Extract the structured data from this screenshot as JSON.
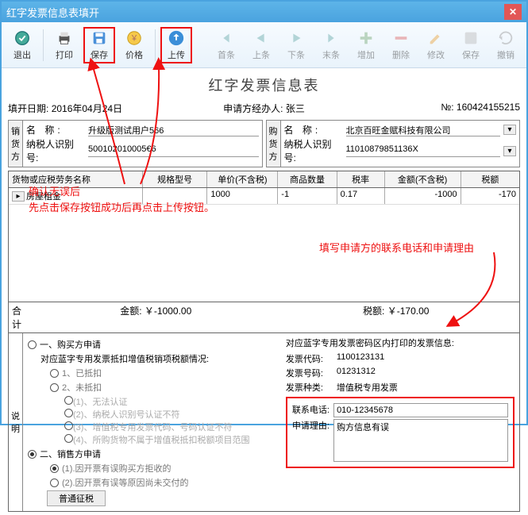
{
  "title": "红字发票信息表填开",
  "toolbar": {
    "exit": "退出",
    "print": "打印",
    "save": "保存",
    "price": "价格",
    "upload": "上传",
    "first": "首条",
    "prev": "上条",
    "next": "下条",
    "last": "末条",
    "add": "增加",
    "del": "删除",
    "modify": "修改",
    "save2": "保存",
    "undo": "撤销"
  },
  "form_title": "红字发票信息表",
  "date_label": "填开日期:",
  "date_value": "2016年04月24日",
  "applicant_label": "申请方经办人:",
  "applicant_value": "张三",
  "num_label": "№:",
  "num_value": "160424155215",
  "seller": {
    "title": "销货方",
    "name_label": "名    称:",
    "name": "升级版测试用户566",
    "tax_label": "纳税人识别号:",
    "tax": "500102010005€6"
  },
  "buyer": {
    "title": "购货方",
    "name_label": "名    称:",
    "name": "北京百旺金赋科技有限公司",
    "tax_label": "纳税人识别号:",
    "tax": "11010879851136X"
  },
  "grid_headers": {
    "name": "货物或应税劳务名称",
    "spec": "规格型号",
    "price": "单价(不含税)",
    "qty": "商品数量",
    "rate": "税率",
    "amt": "金额(不含税)",
    "tax": "税额"
  },
  "rows": [
    {
      "name": "房屋租金",
      "spec": "",
      "price": "1000",
      "qty": "-1",
      "rate": "0.17",
      "amt": "-1000",
      "tax": "-170"
    }
  ],
  "annot1a": "确认无误后",
  "annot1b": "先点击保存按钮成功后再点击上传按钮。",
  "annot2": "填写申请方的联系电话和申请理由",
  "sum": {
    "label": "合    计",
    "amt_label": "金额:",
    "amt": "￥-1000.00",
    "tax_label": "税额:",
    "tax": "￥-170.00"
  },
  "desc_label": "说明",
  "r_buyer": "一、购买方申请",
  "r_buyer_sub": "对应蓝字专用发票抵扣增值税销项税额情况:",
  "r_s1": "1、已抵扣",
  "r_s2": "2、未抵扣",
  "r_s2a": "(1)、无法认证",
  "r_s2b": "(2)、纳税人识别号认证不符",
  "r_s2c": "(3)、增值税专用发票代码、号码认证不符",
  "r_s2d": "(4)、所购货物不属于增值税抵扣税额项目范围",
  "r_seller": "二、销售方申请",
  "r_seller_a": "(1).因开票有误购买方拒收的",
  "r_seller_b": "(2).因开票有误等原因尚未交付的",
  "right_title": "对应蓝字专用发票密码区内打印的发票信息:",
  "inv_code_l": "发票代码:",
  "inv_code": "1100123131",
  "inv_num_l": "发票号码:",
  "inv_num": "01231312",
  "inv_type_l": "发票种类:",
  "inv_type": "增值税专用发票",
  "tel_l": "联系电话:",
  "tel": "010-12345678",
  "reason_l": "申请理由:",
  "reason": "购方信息有误",
  "taxmode": "普通征税"
}
